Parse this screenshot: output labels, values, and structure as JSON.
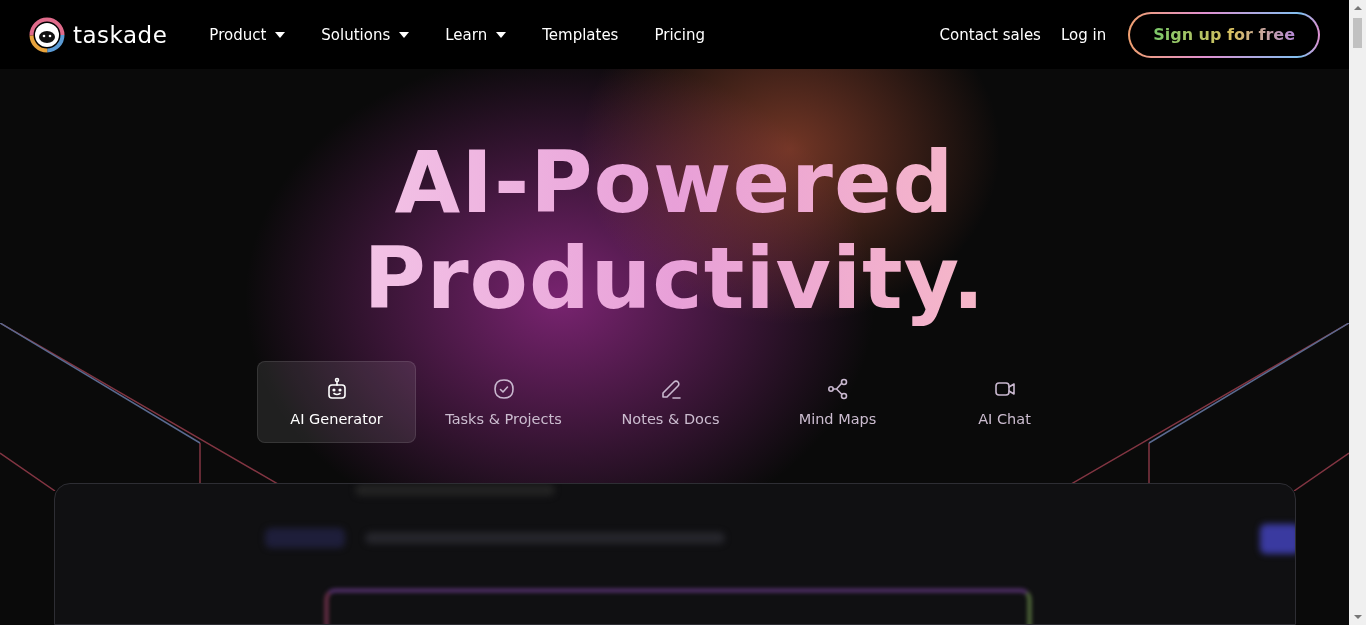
{
  "nav": {
    "logo": "taskade",
    "menu": [
      {
        "label": "Product",
        "dropdown": true
      },
      {
        "label": "Solutions",
        "dropdown": true
      },
      {
        "label": "Learn",
        "dropdown": true
      },
      {
        "label": "Templates",
        "dropdown": false
      },
      {
        "label": "Pricing",
        "dropdown": false
      }
    ],
    "right_links": [
      "Contact sales",
      "Log in"
    ],
    "signup_button": "Sign up for free"
  },
  "hero": {
    "title_lines": [
      "AI-Powered",
      "Productivity."
    ],
    "tabs": [
      {
        "label": "AI Generator",
        "kind": "robot",
        "selected": true
      },
      {
        "label": "Tasks & Projects",
        "kind": "check",
        "selected": false
      },
      {
        "label": "Notes & Docs",
        "kind": "pen",
        "selected": false
      },
      {
        "label": "Mind Maps",
        "kind": "nodes",
        "selected": false
      },
      {
        "label": "AI Chat",
        "kind": "video",
        "selected": false
      }
    ]
  }
}
